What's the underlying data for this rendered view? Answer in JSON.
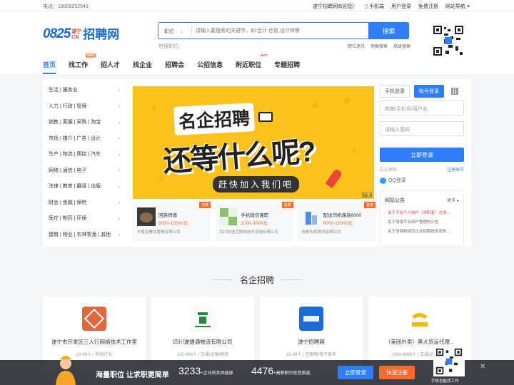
{
  "topbar": {
    "phone": "电话：18008252543",
    "welcome": "遂宁招聘网欢迎您！",
    "mobile": "手机端",
    "user_login": "用户登录",
    "free_register": "免费注册",
    "site_nav": "网站导航"
  },
  "logo": {
    "num": "0825",
    "cn_top": "遂宁",
    "cn_bottom": "CN",
    "name": "招聘网"
  },
  "search": {
    "category": "职位",
    "placeholder": "请输入要搜索的关键字，如:会计,仓管,设计师等",
    "button": "搜索"
  },
  "hot": "热搜职位：",
  "sublinks": [
    "职位速讯",
    "地图搜索",
    "高级搜索"
  ],
  "nav": [
    {
      "label": "首页",
      "tag": ""
    },
    {
      "label": "找工作",
      "tag": "NEW"
    },
    {
      "label": "招人才",
      "tag": "HOT"
    },
    {
      "label": "找企业",
      "tag": ""
    },
    {
      "label": "招聘会",
      "tag": ""
    },
    {
      "label": "公招信息",
      "tag": ""
    },
    {
      "label": "附近职位",
      "tag": ""
    },
    {
      "label": "专题招聘",
      "tag": ""
    }
  ],
  "categories": [
    "生活 | 服务业",
    "人力 | 行政 | 管理",
    "销售 | 客服 | 采购 | 淘宝",
    "市场 | 媒介 | 广告 | 设计",
    "生产 | 物流 | 质控 | 汽车",
    "网络 | 通信 | 电子",
    "法律 | 教育 | 翻译 | 出版",
    "财会 | 金融 | 保险",
    "医疗 | 制药 | 环保",
    "建筑 | 物业 | 农林牧渔 | 其他"
  ],
  "banner": {
    "line1": "名企招聘",
    "line2": "还等什么呢?",
    "line3": "赶快加入我们吧",
    "ad": "广告"
  },
  "jobs": [
    {
      "badge": "急聘",
      "name": "回族师傅",
      "salary": "6000-10000元",
      "company": "丰客宝餐饮管理有限公司"
    },
    {
      "badge": "急聘",
      "name": "手机微信兼职",
      "salary": "2000-3000元",
      "company": "四川秋信互联网技术咨询有限公司"
    },
    {
      "badge": "急聘",
      "name": "配送司机保底8000",
      "salary": "8000-12000元",
      "company": "佐都传和物流有限公司"
    }
  ],
  "login": {
    "tab_mobile": "手机登录",
    "tab_account": "账号登录",
    "user_placeholder": "邮箱/手机号/用户名",
    "pwd_placeholder": "请输入密码",
    "submit": "立即登录",
    "forgot": "忘记密码",
    "register": "注册账号",
    "qq": "QQ登录"
  },
  "notice": {
    "title": "网站公告",
    "more": "更多",
    "items": [
      "关于平台个人用户（求职者）注册...",
      "关于加强平台用户管理的公告",
      "关于加强和规范企业招聘信息发布..."
    ]
  },
  "section_title": "名企招聘",
  "companies": [
    {
      "name": "遂宁市开发区三人行网络技术工作室",
      "meta": "20-99人 | 其他行业"
    },
    {
      "name": "四川遂捷通物流有限公司",
      "meta": "100-499人 | 交通/运输/物流"
    },
    {
      "name": "遂宁招聘网",
      "meta": "20-99人 | 互联网/电子商务"
    },
    {
      "name": "（美团外卖）黑犬货运代理...",
      "meta": "1000-9999人 | 交通/运输/物流"
    }
  ],
  "bottom": {
    "slogan": "海量职位 让求职更简单",
    "n1": "3233",
    "s1": "+企业的共同选择",
    "n2": "4476",
    "s2": "+高薪职位任您挑选",
    "login": "立即登录",
    "register": "快速注册",
    "qr_caption": "手机也能找工作"
  },
  "colors": {
    "primary": "#2d7ef7",
    "accent": "#ff6a2c",
    "banner": "#fbc21b"
  }
}
